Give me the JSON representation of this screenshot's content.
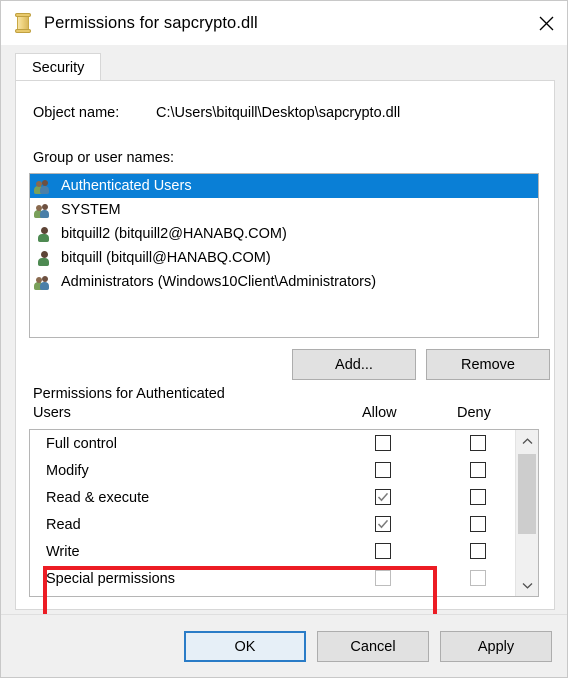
{
  "window": {
    "title": "Permissions for sapcrypto.dll",
    "icon": "permissions-scroll-icon",
    "close_label": "Close"
  },
  "tabs": [
    {
      "label": "Security",
      "active": true
    }
  ],
  "object": {
    "label": "Object name:",
    "value": "C:\\Users\\bitquill\\Desktop\\sapcrypto.dll"
  },
  "group_section": {
    "label": "Group or user names:",
    "items": [
      {
        "name": "Authenticated Users",
        "icon": "group-icon",
        "selected": true
      },
      {
        "name": "SYSTEM",
        "icon": "group-icon",
        "selected": false
      },
      {
        "name": "bitquill2 (bitquill2@HANABQ.COM)",
        "icon": "user-icon",
        "selected": false
      },
      {
        "name": "bitquill (bitquill@HANABQ.COM)",
        "icon": "user-icon",
        "selected": false
      },
      {
        "name": "Administrators (Windows10Client\\Administrators)",
        "icon": "group-icon",
        "selected": false
      }
    ],
    "add_label": "Add...",
    "remove_label": "Remove"
  },
  "permissions_section": {
    "heading_line1": "Permissions for Authenticated",
    "heading_line2": "Users",
    "allow_header": "Allow",
    "deny_header": "Deny",
    "rows": [
      {
        "name": "Full control",
        "allow": false,
        "deny": false,
        "dimmed": false,
        "highlighted": false
      },
      {
        "name": "Modify",
        "allow": false,
        "deny": false,
        "dimmed": false,
        "highlighted": false
      },
      {
        "name": "Read & execute",
        "allow": true,
        "deny": false,
        "dimmed": false,
        "highlighted": true
      },
      {
        "name": "Read",
        "allow": true,
        "deny": false,
        "dimmed": false,
        "highlighted": true
      },
      {
        "name": "Write",
        "allow": false,
        "deny": false,
        "dimmed": false,
        "highlighted": false
      },
      {
        "name": "Special permissions",
        "allow": false,
        "deny": false,
        "dimmed": true,
        "highlighted": false
      }
    ]
  },
  "footer": {
    "ok_label": "OK",
    "cancel_label": "Cancel",
    "apply_label": "Apply"
  },
  "annotation": {
    "type": "rectangle-highlight",
    "color": "#ec1c24",
    "targets": [
      "Read & execute",
      "Read"
    ]
  },
  "colors": {
    "selection_blue": "#0a7fd6",
    "annotation_red": "#ec1c24",
    "focus_blue": "#2a7cc7",
    "dialog_bg": "#f0f0f0",
    "field_bg": "#ffffff"
  }
}
